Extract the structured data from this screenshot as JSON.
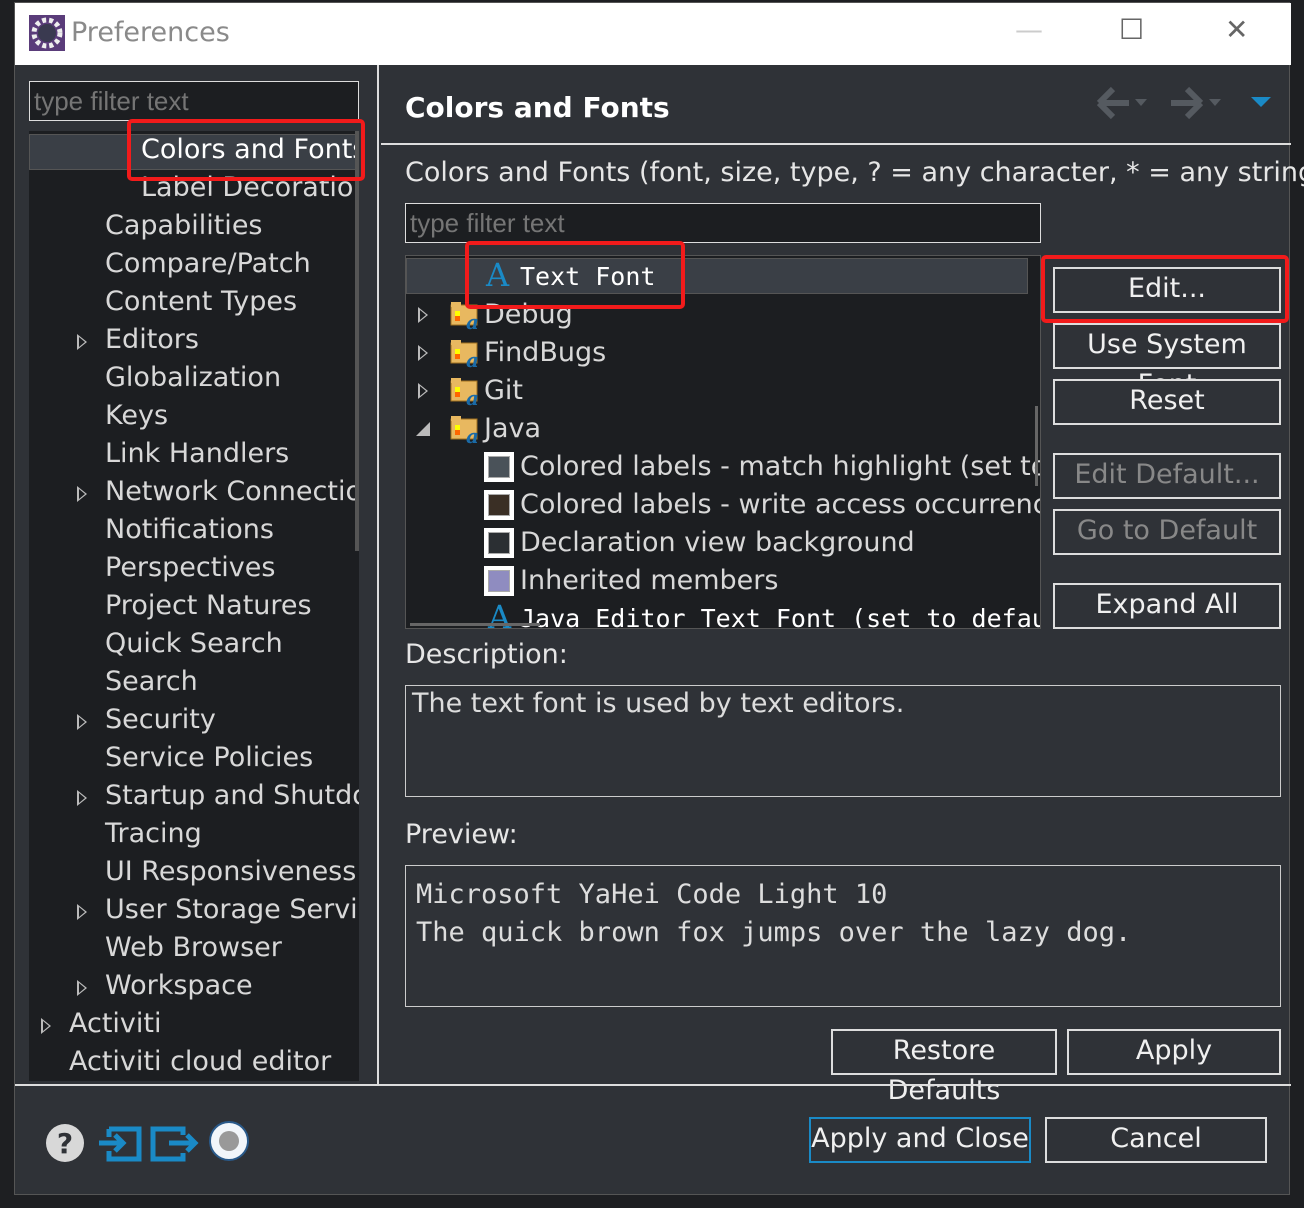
{
  "window": {
    "title": "Preferences",
    "icon": "gear-icon",
    "minimize": "—",
    "maximize": "☐",
    "close": "✕"
  },
  "sidebar": {
    "filter_placeholder": "type filter text",
    "items": [
      {
        "label": "Colors and Fonts",
        "level": 2,
        "expandable": false,
        "selected": true
      },
      {
        "label": "Label Decorations",
        "level": 2,
        "expandable": false
      },
      {
        "label": "Capabilities",
        "level": 1,
        "expandable": false
      },
      {
        "label": "Compare/Patch",
        "level": 1,
        "expandable": false
      },
      {
        "label": "Content Types",
        "level": 1,
        "expandable": false
      },
      {
        "label": "Editors",
        "level": 1,
        "expandable": true
      },
      {
        "label": "Globalization",
        "level": 1,
        "expandable": false
      },
      {
        "label": "Keys",
        "level": 1,
        "expandable": false
      },
      {
        "label": "Link Handlers",
        "level": 1,
        "expandable": false
      },
      {
        "label": "Network Connections",
        "level": 1,
        "expandable": true
      },
      {
        "label": "Notifications",
        "level": 1,
        "expandable": false
      },
      {
        "label": "Perspectives",
        "level": 1,
        "expandable": false
      },
      {
        "label": "Project Natures",
        "level": 1,
        "expandable": false
      },
      {
        "label": "Quick Search",
        "level": 1,
        "expandable": false
      },
      {
        "label": "Search",
        "level": 1,
        "expandable": false
      },
      {
        "label": "Security",
        "level": 1,
        "expandable": true
      },
      {
        "label": "Service Policies",
        "level": 1,
        "expandable": false
      },
      {
        "label": "Startup and Shutdown",
        "level": 1,
        "expandable": true
      },
      {
        "label": "Tracing",
        "level": 1,
        "expandable": false
      },
      {
        "label": "UI Responsiveness",
        "level": 1,
        "expandable": false
      },
      {
        "label": "User Storage Service",
        "level": 1,
        "expandable": true
      },
      {
        "label": "Web Browser",
        "level": 1,
        "expandable": false
      },
      {
        "label": "Workspace",
        "level": 1,
        "expandable": true
      },
      {
        "label": "Activiti",
        "level": 0,
        "expandable": true
      },
      {
        "label": "Activiti cloud editor",
        "level": 0,
        "expandable": false
      }
    ]
  },
  "main": {
    "title": "Colors and Fonts",
    "nav": {
      "back": "back-arrow-icon",
      "forward": "forward-arrow-icon",
      "menu": "view-menu-icon"
    },
    "intro": "Colors and Fonts (font, size, type, ? = any character, * = any string) :",
    "filter_placeholder": "type filter text",
    "tree": [
      {
        "label": "Text Font",
        "type": "font",
        "selected": true
      },
      {
        "label": "Debug",
        "type": "category",
        "expanded": false
      },
      {
        "label": "FindBugs",
        "type": "category",
        "expanded": false
      },
      {
        "label": "Git",
        "type": "category",
        "expanded": false
      },
      {
        "label": "Java",
        "type": "category",
        "expanded": true
      },
      {
        "label": "Colored labels - match highlight (set to default: Search",
        "type": "color",
        "color": "#4a5259"
      },
      {
        "label": "Colored labels - write access occurrences",
        "type": "color",
        "color": "#3a2f25"
      },
      {
        "label": "Declaration view background",
        "type": "color",
        "color": "#2b2f33"
      },
      {
        "label": "Inherited members",
        "type": "color",
        "color": "#8f8cc0"
      },
      {
        "label": "Java Editor Text Font (set to default: Text Font)",
        "type": "font"
      }
    ],
    "buttons": {
      "edit": "Edit...",
      "use_system_font": "Use System Font",
      "reset": "Reset",
      "edit_default": "Edit Default...",
      "go_to_default": "Go to Default",
      "expand_all": "Expand All"
    },
    "description_label": "Description:",
    "description": "The text font is used by text editors.",
    "preview_label": "Preview:",
    "preview": [
      "Microsoft YaHei Code Light 10",
      "The quick brown fox jumps over the lazy dog."
    ],
    "restore_defaults": "Restore Defaults",
    "apply": "Apply"
  },
  "footer": {
    "icons": [
      "help-icon",
      "import-icon",
      "export-icon",
      "record-icon"
    ],
    "apply_and_close": "Apply and Close",
    "cancel": "Cancel"
  },
  "colors": {
    "accent": "#1a8ac6",
    "highlight": "#f21b1b",
    "dialog_bg": "#2f3237",
    "tree_bg": "#1c1e21"
  }
}
